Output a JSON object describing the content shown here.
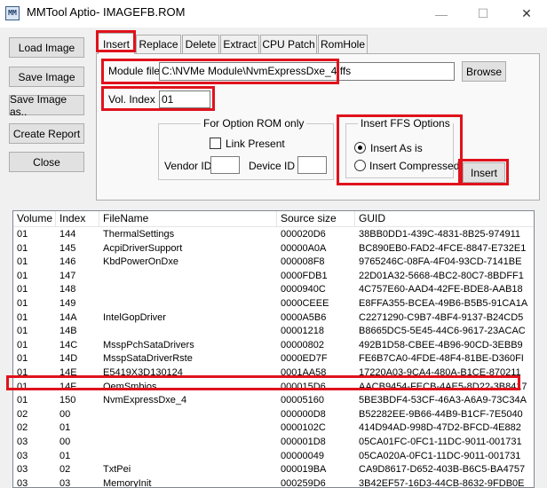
{
  "window": {
    "title": "MMTool Aptio- IMAGEFB.ROM",
    "icon_text": "MM",
    "min_glyph": "—",
    "max_glyph": "☐",
    "close_glyph": "✕"
  },
  "left_buttons": {
    "load": "Load Image",
    "save": "Save Image",
    "save_as": "Save Image as..",
    "report": "Create Report",
    "close": "Close"
  },
  "tabs": [
    "Insert",
    "Replace",
    "Delete",
    "Extract",
    "CPU Patch",
    "RomHole"
  ],
  "insert_panel": {
    "module_file_label": "Module file",
    "module_file_value": "C:\\NVMe Module\\NvmExpressDxe_4.ffs",
    "browse": "Browse",
    "vol_index_label": "Vol. Index",
    "vol_index_value": "01",
    "option_rom": {
      "title": "For Option ROM only",
      "link_present": "Link Present",
      "vendor_id": "Vendor ID",
      "device_id": "Device ID"
    },
    "ffs_options": {
      "title": "Insert FFS Options",
      "as_is": "Insert As is",
      "compressed": "Insert Compressed"
    },
    "insert_button": "Insert"
  },
  "table": {
    "columns": [
      "Volume",
      "Index",
      "FileName",
      "Source size",
      "GUID"
    ],
    "rows": [
      [
        "01",
        "144",
        "ThermalSettings",
        "000020D6",
        "38BB0DD1-439C-4831-8B25-974911"
      ],
      [
        "01",
        "145",
        "AcpiDriverSupport",
        "00000A0A",
        "BC890EB0-FAD2-4FCE-8847-E732E1"
      ],
      [
        "01",
        "146",
        "KbdPowerOnDxe",
        "000008F8",
        "9765246C-08FA-4F04-93CD-7141BE"
      ],
      [
        "01",
        "147",
        "",
        "0000FDB1",
        "22D01A32-5668-4BC2-80C7-8BDFF1"
      ],
      [
        "01",
        "148",
        "",
        "0000940C",
        "4C757E60-AAD4-42FE-BDE8-AAB18"
      ],
      [
        "01",
        "149",
        "",
        "0000CEEE",
        "E8FFA355-BCEA-49B6-B5B5-91CA1A"
      ],
      [
        "01",
        "14A",
        "IntelGopDriver",
        "0000A5B6",
        "C2271290-C9B7-4BF4-9137-B24CD5"
      ],
      [
        "01",
        "14B",
        "",
        "00001218",
        "B8665DC5-5E45-44C6-9617-23ACAC"
      ],
      [
        "01",
        "14C",
        "MsspPchSataDrivers",
        "00000802",
        "492B1D58-CBEE-4B96-90CD-3EBB9"
      ],
      [
        "01",
        "14D",
        "MsspSataDriverRste",
        "0000ED7F",
        "FE6B7CA0-4FDE-48F4-81BE-D360FI"
      ],
      [
        "01",
        "14E",
        "E5419X3D130124",
        "0001AA58",
        "17220A03-9CA4-480A-B1CE-870211"
      ],
      [
        "01",
        "14F",
        "OemSmbios",
        "000015D6",
        "AACB9454-FECB-4AE5-8D22-3B8417"
      ],
      [
        "01",
        "150",
        "NvmExpressDxe_4",
        "00005160",
        "5BE3BDF4-53CF-46A3-A6A9-73C34A"
      ],
      [
        "02",
        "00",
        "",
        "000000D8",
        "B52282EE-9B66-44B9-B1CF-7E5040"
      ],
      [
        "02",
        "01",
        "",
        "0000102C",
        "414D94AD-998D-47D2-BFCD-4E882"
      ],
      [
        "03",
        "00",
        "",
        "000001D8",
        "05CA01FC-0FC1-11DC-9011-001731"
      ],
      [
        "03",
        "01",
        "",
        "00000049",
        "05CA020A-0FC1-11DC-9011-001731"
      ],
      [
        "03",
        "02",
        "TxtPei",
        "000019BA",
        "CA9D8617-D652-403B-B6C5-BA4757"
      ],
      [
        "03",
        "03",
        "MemoryInit",
        "000259D6",
        "3B42EF57-16D3-44CB-8632-9FDB0E"
      ]
    ]
  }
}
